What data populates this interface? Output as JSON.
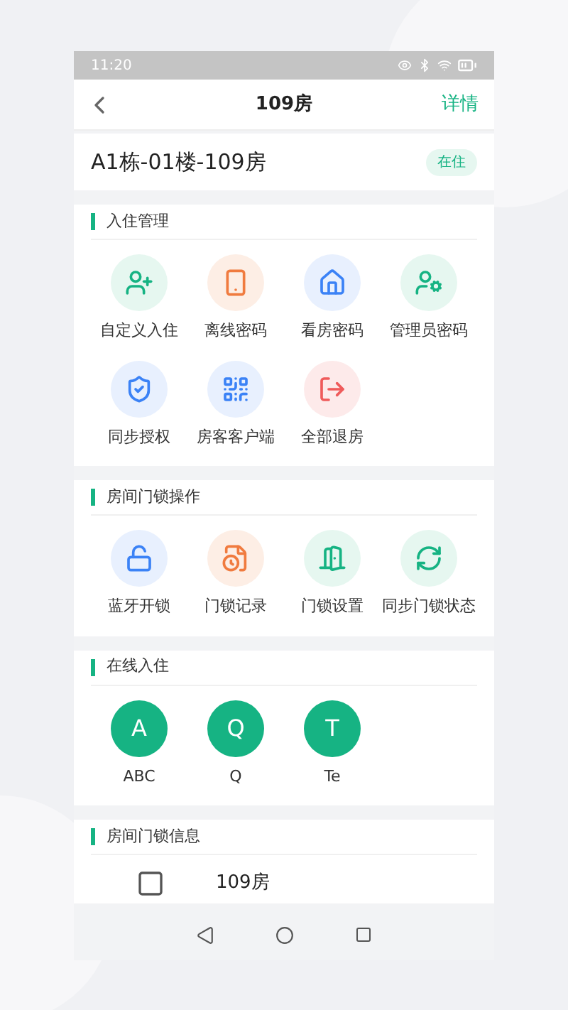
{
  "status_bar": {
    "time": "11:20"
  },
  "header": {
    "title": "109房",
    "action": "详情"
  },
  "room": {
    "name": "A1栋-01楼-109房",
    "status": "在住"
  },
  "sections": [
    {
      "kind": "grid",
      "title": "入住管理",
      "items": [
        "自定义入住",
        "离线密码",
        "看房密码",
        "管理员密码",
        "同步授权",
        "房客客户端",
        "全部退房"
      ]
    },
    {
      "kind": "grid",
      "title": "房间门锁操作",
      "items": [
        "蓝牙开锁",
        "门锁记录",
        "门锁设置",
        "同步门锁状态"
      ]
    },
    {
      "kind": "avatars",
      "title": "在线入住",
      "items": [
        {
          "initial": "A",
          "name": "ABC"
        },
        {
          "initial": "Q",
          "name": "Q"
        },
        {
          "initial": "T",
          "name": "Te"
        }
      ]
    },
    {
      "kind": "info",
      "title": "房间门锁信息",
      "items": [
        "109房"
      ]
    }
  ]
}
